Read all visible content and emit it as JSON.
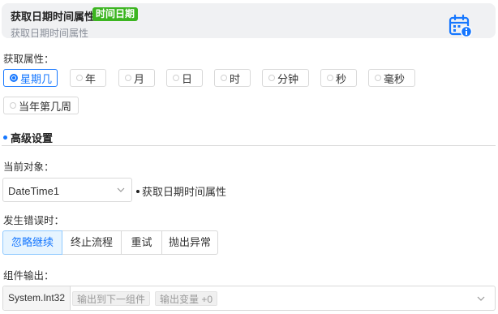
{
  "header": {
    "title": "获取日期时间属性",
    "tag": "时间日期",
    "subtitle": "获取日期时间属性",
    "icon": "calendar-info-icon",
    "accent": "#1677ff",
    "tag_color": "#3cb521"
  },
  "attribute": {
    "label": "获取属性：",
    "options": [
      "星期几",
      "年",
      "月",
      "日",
      "时",
      "分钟",
      "秒",
      "毫秒",
      "当年第几周"
    ],
    "selected": "星期几"
  },
  "advanced": {
    "title": "高级设置"
  },
  "target": {
    "label": "当前对象：",
    "value": "DateTime1",
    "description": "获取日期时间属性"
  },
  "error": {
    "label": "发生错误时：",
    "options": [
      "忽略继续",
      "终止流程",
      "重试",
      "抛出异常"
    ],
    "selected": "忽略继续"
  },
  "output": {
    "label": "组件输出：",
    "type": "System.Int32",
    "chip_next": "输出到下一组件",
    "chip_var": "输出变量 +0"
  }
}
